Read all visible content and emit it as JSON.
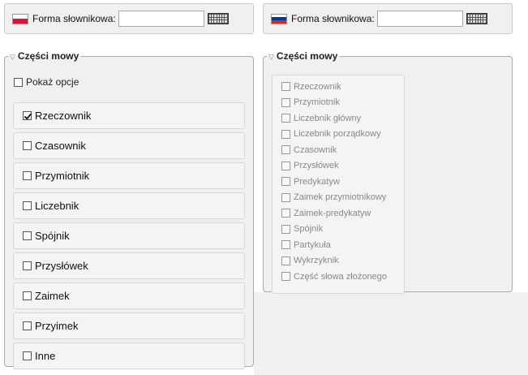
{
  "left_form": {
    "label": "Forma słownikowa:",
    "value": "",
    "flag_colors": [
      "#ffffff",
      "#dc143c"
    ]
  },
  "right_form": {
    "label": "Forma słownikowa:",
    "value": "",
    "flag_colors": [
      "#ffffff",
      "#0039a6",
      "#d52b1e"
    ]
  },
  "left_pos": {
    "legend": "Części mowy",
    "show_options": "Pokaż opcje",
    "items": [
      {
        "label": "Rzeczownik",
        "checked": true
      },
      {
        "label": "Czasownik",
        "checked": false
      },
      {
        "label": "Przymiotnik",
        "checked": false
      },
      {
        "label": "Liczebnik",
        "checked": false
      },
      {
        "label": "Spójnik",
        "checked": false
      },
      {
        "label": "Przysłówek",
        "checked": false
      },
      {
        "label": "Zaimek",
        "checked": false
      },
      {
        "label": "Przyimek",
        "checked": false
      },
      {
        "label": "Inne",
        "checked": false
      }
    ]
  },
  "right_pos": {
    "legend": "Części mowy",
    "items": [
      {
        "label": "Rzeczownik"
      },
      {
        "label": "Przymiotnik"
      },
      {
        "label": "Liczebnik główny"
      },
      {
        "label": "Liczebnik porządkowy"
      },
      {
        "label": "Czasownik"
      },
      {
        "label": "Przysłówek"
      },
      {
        "label": "Predykatyw"
      },
      {
        "label": "Zaimek przymiotnikowy"
      },
      {
        "label": "Zaimek-predykatyw"
      },
      {
        "label": "Spójnik"
      },
      {
        "label": "Partykuła"
      },
      {
        "label": "Wykrzyknik"
      },
      {
        "label": "Część słowa złożonego"
      }
    ]
  }
}
